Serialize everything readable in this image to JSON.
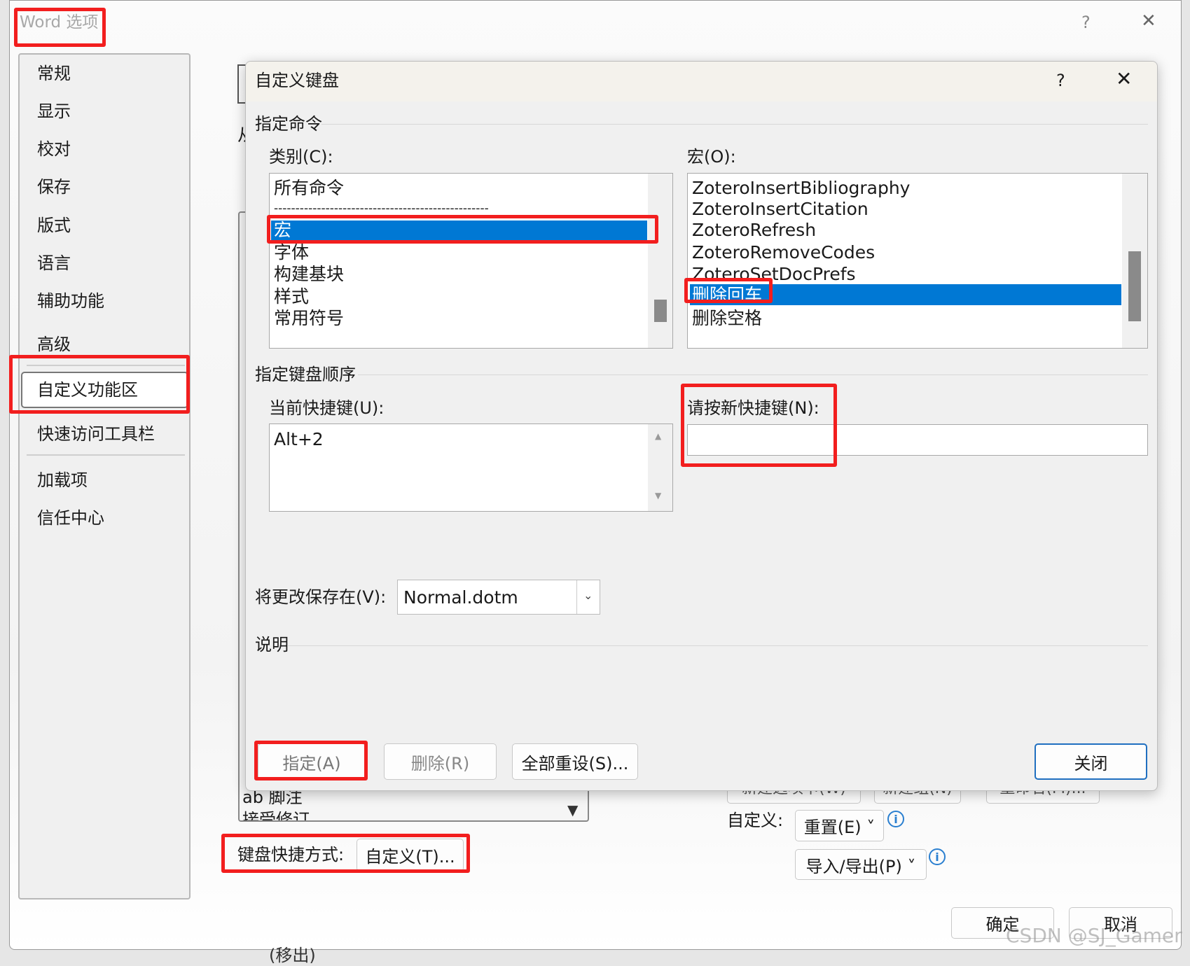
{
  "window": {
    "title": "Word 选项",
    "help": "?",
    "close": "✕"
  },
  "nav": {
    "items": [
      "常规",
      "显示",
      "校对",
      "保存",
      "版式",
      "语言",
      "辅助功能",
      "高级",
      "自定义功能区",
      "快速访问工具栏",
      "加载项",
      "信任中心"
    ],
    "selected": "自定义功能区"
  },
  "background": {
    "from_char": "从",
    "list_items": [
      "ab 脚注",
      "接受修订"
    ],
    "hidden_buttons": [
      "新建选项卡(W)",
      "新建组(N)",
      "重命名(M)..."
    ],
    "customize_label": "自定义:",
    "reset_button": "重置(E) ˅",
    "import_export_button": "导入/导出(P) ˅",
    "keyboard_label": "键盘快捷方式:",
    "keyboard_button": "自定义(T)...",
    "ok": "确定",
    "cancel": "取消",
    "below_text": "(移出)"
  },
  "dialog": {
    "title": "自定义键盘",
    "help": "?",
    "close": "✕",
    "section_command": "指定命令",
    "category_label": "类别(C):",
    "categories": [
      "所有命令",
      "--------------------------------------------------",
      "宏",
      "字体",
      "构建基块",
      "样式",
      "常用符号"
    ],
    "selected_category": "宏",
    "macro_label": "宏(O):",
    "macros": [
      "ZoteroInsertBibliography",
      "ZoteroInsertCitation",
      "ZoteroRefresh",
      "ZoteroRemoveCodes",
      "ZoteroSetDocPrefs",
      "删除回车",
      "删除空格"
    ],
    "selected_macro": "删除回车",
    "section_keys": "指定键盘顺序",
    "current_keys_label": "当前快捷键(U):",
    "current_keys": [
      "Alt+2"
    ],
    "new_key_label": "请按新快捷键(N):",
    "new_key_value": "",
    "save_in_label": "将更改保存在(V):",
    "save_in_value": "Normal.dotm",
    "description_label": "说明",
    "assign_button": "指定(A)",
    "remove_button": "删除(R)",
    "reset_all_button": "全部重设(S)...",
    "close_button": "关闭"
  },
  "watermark": "CSDN @SJ_Gamer",
  "colors": {
    "selection": "#0078d4",
    "highlight_box": "#f21e1e",
    "info": "#2a7fd0"
  }
}
